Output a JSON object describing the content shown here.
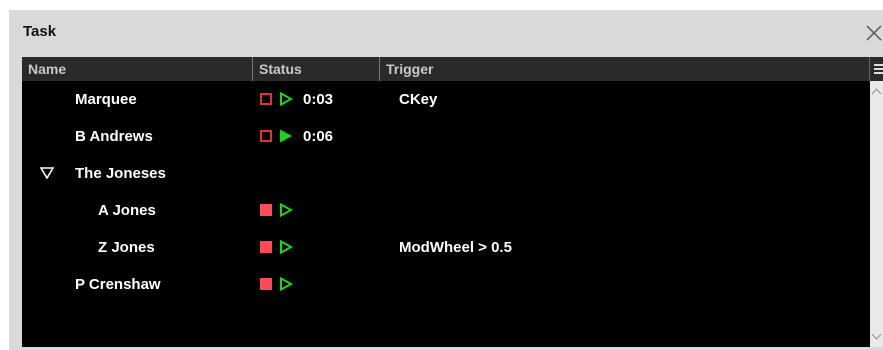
{
  "window": {
    "title": "Task"
  },
  "columns": {
    "name": "Name",
    "status": "Status",
    "trigger": "Trigger"
  },
  "rows": [
    {
      "name": "Marquee",
      "stop": "outline",
      "play": "outline",
      "time": "0:03",
      "trigger": "CKey"
    },
    {
      "name": "B Andrews",
      "stop": "outline",
      "play": "filled",
      "time": "0:06",
      "trigger": ""
    },
    {
      "name": "The Joneses",
      "group": true,
      "expanded": true
    },
    {
      "name": "A Jones",
      "stop": "filled",
      "play": "outline",
      "time": "",
      "trigger": ""
    },
    {
      "name": "Z Jones",
      "stop": "filled",
      "play": "outline",
      "time": "",
      "trigger": "ModWheel > 0.5"
    },
    {
      "name": "P Crenshaw",
      "stop": "filled",
      "play": "outline",
      "time": "",
      "trigger": ""
    }
  ],
  "colors": {
    "stop": "#ff4a57",
    "play": "#1fd31f",
    "background": "#000000"
  },
  "icons": {
    "close": "close-icon",
    "menu": "column-menu-icon",
    "expand": "triangle-down-icon",
    "stop": "stop-icon",
    "play": "play-icon"
  }
}
